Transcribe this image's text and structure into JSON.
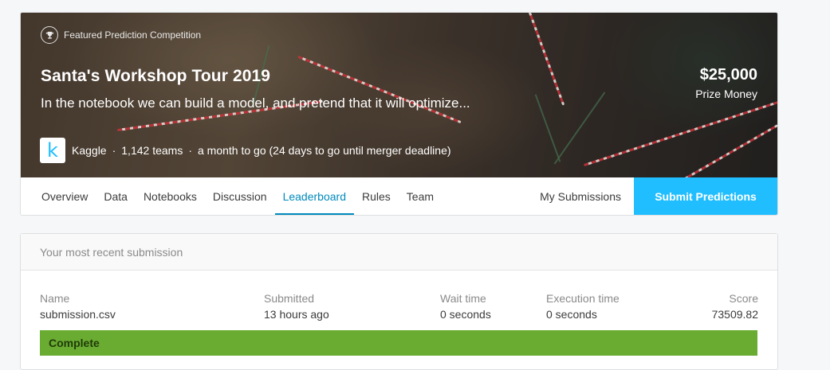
{
  "competition": {
    "featured_label": "Featured Prediction Competition",
    "title": "Santa's Workshop Tour 2019",
    "subtitle": "In the notebook we can build a model, and pretend that it will optimize...",
    "prize_amount": "$25,000",
    "prize_label": "Prize Money",
    "host": "Kaggle",
    "host_logo_letter": "k",
    "teams": "1,142 teams",
    "deadline": "a month to go (24 days to go until merger deadline)",
    "separator": "·",
    "icons": {
      "featured": "trophy-icon",
      "host": "kaggle-logo"
    }
  },
  "nav": {
    "tabs": [
      {
        "label": "Overview",
        "active": false
      },
      {
        "label": "Data",
        "active": false
      },
      {
        "label": "Notebooks",
        "active": false
      },
      {
        "label": "Discussion",
        "active": false
      },
      {
        "label": "Leaderboard",
        "active": true
      },
      {
        "label": "Rules",
        "active": false
      },
      {
        "label": "Team",
        "active": false
      }
    ],
    "my_submissions": "My Submissions",
    "submit_button": "Submit Predictions"
  },
  "submission": {
    "header": "Your most recent submission",
    "name_label": "Name",
    "name_value": "submission.csv",
    "submitted_label": "Submitted",
    "submitted_value": "13 hours ago",
    "wait_label": "Wait time",
    "wait_value": "0 seconds",
    "exec_label": "Execution time",
    "exec_value": "0 seconds",
    "score_label": "Score",
    "score_value": "73509.82",
    "status": "Complete"
  },
  "colors": {
    "accent": "#20beff",
    "active_tab": "#008abc",
    "status_complete": "#6aab32"
  }
}
